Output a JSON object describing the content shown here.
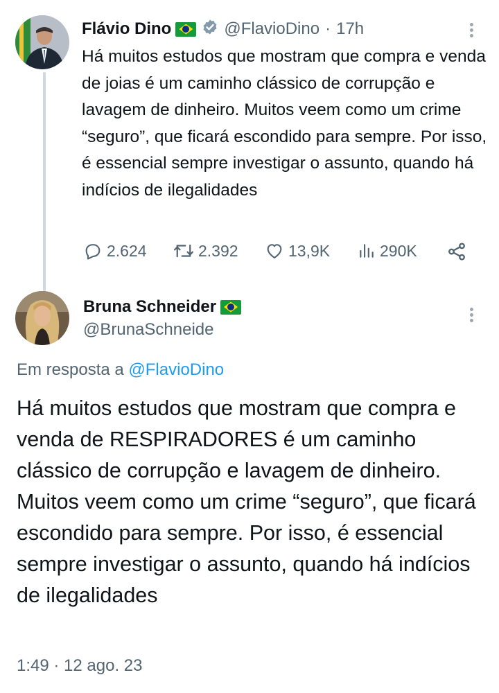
{
  "tweet1": {
    "display_name": "Flávio Dino",
    "handle": "@FlavioDino",
    "separator": "·",
    "time": "17h",
    "text": "Há muitos estudos que mostram que compra e venda de joias é um caminho clássico de corrupção e lavagem de dinheiro. Muitos veem como um crime “seguro”, que ficará escondido para sempre. Por isso, é essencial sempre investigar o assunto, quando há indícios de ilegalidades",
    "stats": {
      "replies": "2.624",
      "retweets": "2.392",
      "likes": "13,9K",
      "views": "290K"
    }
  },
  "tweet2": {
    "display_name": "Bruna Schneider",
    "handle": "@BrunaSchneide",
    "reply_prefix": "Em resposta a",
    "reply_to": "@FlavioDino",
    "text": "Há muitos estudos que mostram que compra e venda de RESPIRADORES é um caminho clássico de corrupção e lavagem de dinheiro. Muitos veem como um crime “seguro”, que ficará escondido para sempre. Por isso, é essencial sempre investigar o assunto, quando há indícios de ilegalidades",
    "timestamp": "1:49 · 12 ago. 23"
  },
  "colors": {
    "text": "#0f1419",
    "muted": "#536471",
    "link": "#1d9bf0",
    "thread_line": "#cfd9de"
  },
  "icons": [
    "more-icon",
    "verified-icon",
    "reply-icon",
    "retweet-icon",
    "like-icon",
    "views-icon",
    "share-icon",
    "brazil-flag-icon"
  ]
}
